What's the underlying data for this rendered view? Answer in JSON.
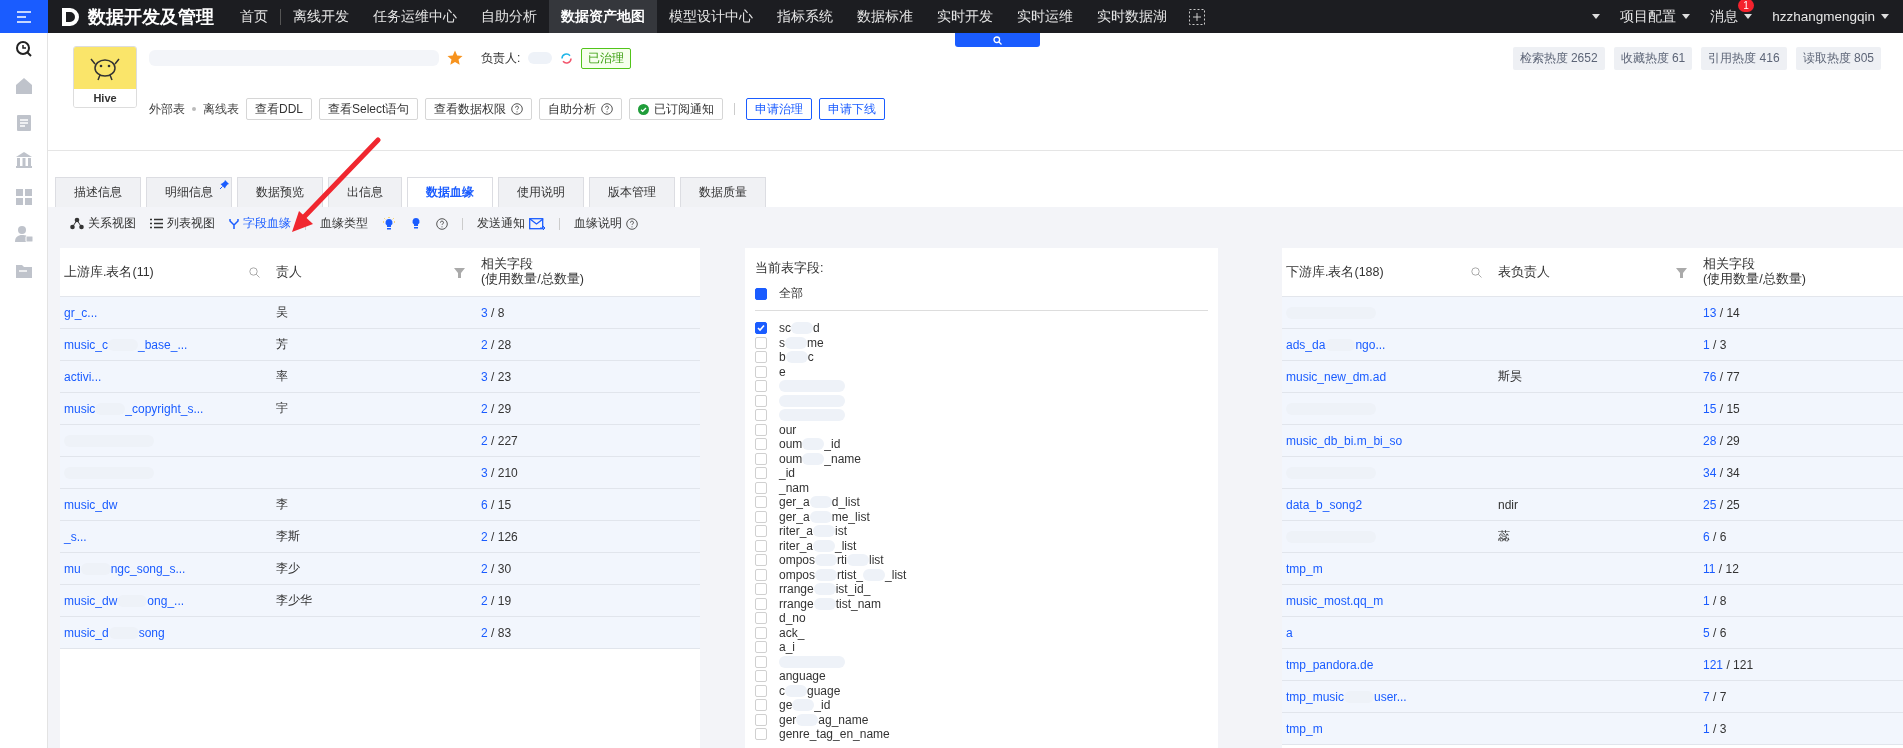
{
  "nav": {
    "brand": "数据开发及管理",
    "items": [
      {
        "label": "首页",
        "selected": false
      },
      {
        "label": "离线开发",
        "selected": false
      },
      {
        "label": "任务运维中心",
        "selected": false
      },
      {
        "label": "自助分析",
        "selected": false
      },
      {
        "label": "数据资产地图",
        "selected": true
      },
      {
        "label": "模型设计中心",
        "selected": false
      },
      {
        "label": "指标系统",
        "selected": false
      },
      {
        "label": "数据标准",
        "selected": false
      },
      {
        "label": "实时开发",
        "selected": false
      },
      {
        "label": "实时运维",
        "selected": false
      },
      {
        "label": "实时数据湖",
        "selected": false
      }
    ],
    "menus": [
      "项目配置",
      "消息",
      "hzzhangmengqin"
    ],
    "message_badge": "1"
  },
  "sidebar": {
    "items": [
      {
        "kind": "search",
        "selected": true
      },
      {
        "kind": "home",
        "selected": false
      },
      {
        "kind": "document",
        "selected": false
      },
      {
        "kind": "bank",
        "selected": false
      },
      {
        "kind": "grid",
        "selected": false
      },
      {
        "kind": "user",
        "selected": false
      },
      {
        "kind": "folder",
        "selected": false
      }
    ]
  },
  "header": {
    "logo_label": "Hive",
    "starred": true,
    "owner_label": "负责人:",
    "status": "已治理",
    "table_tags": [
      "外部表",
      "离线表"
    ],
    "buttons": [
      {
        "label": "查看DDL",
        "kind": "plain"
      },
      {
        "label": "查看Select语句",
        "kind": "plain"
      },
      {
        "label": "查看数据权限",
        "kind": "help"
      },
      {
        "label": "自助分析",
        "kind": "help"
      },
      {
        "label": "已订阅通知",
        "kind": "subscribed"
      },
      {
        "label": "申请治理",
        "kind": "primary"
      },
      {
        "label": "申请下线",
        "kind": "primary"
      }
    ],
    "stats": [
      "检索热度 2652",
      "收藏热度 61",
      "引用热度 416",
      "读取热度 805"
    ]
  },
  "tabs": [
    {
      "label": "描述信息",
      "selected": false,
      "pinned": false
    },
    {
      "label": "明细信息",
      "selected": false,
      "pinned": true
    },
    {
      "label": "数据预览",
      "selected": false,
      "pinned": false
    },
    {
      "label": "出信息",
      "selected": false,
      "pinned": false
    },
    {
      "label": "数据血缘",
      "selected": true,
      "pinned": false
    },
    {
      "label": "使用说明",
      "selected": false,
      "pinned": false
    },
    {
      "label": "版本管理",
      "selected": false,
      "pinned": false
    },
    {
      "label": "数据质量",
      "selected": false,
      "pinned": false
    }
  ],
  "toolbar": {
    "views": [
      {
        "label": "关系视图",
        "kind": "graph",
        "selected": false
      },
      {
        "label": "列表视图",
        "kind": "list",
        "selected": false
      },
      {
        "label": "字段血缘",
        "kind": "fork",
        "selected": true
      }
    ],
    "lineage_type_label": "血缘类型",
    "notify_label": "发送通知",
    "help_label": "血缘说明"
  },
  "upstream": {
    "count_separator": "/",
    "columns": [
      "上游库.表名(11)",
      "责人",
      "相关字段\n(使用数量/总数量)"
    ],
    "rows": [
      {
        "name": [
          "gr_c..."
        ],
        "owner": [
          "吴"
        ],
        "used": "3",
        "total": "8"
      },
      {
        "name": [
          "music_c",
          "_base_..."
        ],
        "owner": [
          "芳"
        ],
        "used": "2",
        "total": "28"
      },
      {
        "name": [
          "activi..."
        ],
        "owner": [
          "率"
        ],
        "used": "3",
        "total": "23"
      },
      {
        "name": [
          "music",
          "_copyright_s..."
        ],
        "owner": [
          "宇"
        ],
        "used": "2",
        "total": "29"
      },
      {
        "used": "2",
        "total": "227"
      },
      {
        "used": "3",
        "total": "210"
      },
      {
        "name": [
          "music_dw"
        ],
        "owner": [
          "李"
        ],
        "used": "6",
        "total": "15"
      },
      {
        "name": [
          "_s..."
        ],
        "owner": [
          "李斯"
        ],
        "used": "2",
        "total": "126"
      },
      {
        "name": [
          "mu",
          "ngc_song_s..."
        ],
        "owner": [
          "李少"
        ],
        "used": "2",
        "total": "30"
      },
      {
        "name": [
          "music_dw",
          "ong_..."
        ],
        "owner": [
          "李少华"
        ],
        "used": "2",
        "total": "19"
      },
      {
        "name": [
          "music_d",
          "song"
        ],
        "used": "2",
        "total": "83"
      }
    ]
  },
  "current_fields": {
    "label": "当前表字段:",
    "all_label": "全部",
    "all_indeterminate": true,
    "items": [
      {
        "parts": [
          "sc",
          "d"
        ],
        "checked": true
      },
      {
        "parts": [
          "s",
          "me"
        ],
        "checked": false
      },
      {
        "parts": [
          "b",
          "c"
        ],
        "checked": false
      },
      {
        "parts": [
          "e"
        ],
        "checked": false
      },
      {
        "checked": false
      },
      {
        "checked": false
      },
      {
        "checked": false
      },
      {
        "parts": [
          "our"
        ],
        "checked": false
      },
      {
        "parts": [
          "oum",
          "_id"
        ],
        "checked": false
      },
      {
        "parts": [
          "oum",
          "_name"
        ],
        "checked": false
      },
      {
        "parts": [
          "_id"
        ],
        "checked": false
      },
      {
        "parts": [
          "_nam"
        ],
        "checked": false
      },
      {
        "parts": [
          "ger_a",
          "d_list"
        ],
        "checked": false
      },
      {
        "parts": [
          "ger_a",
          "me_list"
        ],
        "checked": false
      },
      {
        "parts": [
          "riter_a",
          "ist"
        ],
        "checked": false
      },
      {
        "parts": [
          "riter_a",
          "_list"
        ],
        "checked": false
      },
      {
        "parts": [
          "ompos",
          "rti",
          "list"
        ],
        "checked": false
      },
      {
        "parts": [
          "ompos",
          "rtist_",
          "_list"
        ],
        "checked": false
      },
      {
        "parts": [
          "rrange",
          "ist_id_"
        ],
        "checked": false
      },
      {
        "parts": [
          "rrange",
          "tist_nam"
        ],
        "checked": false
      },
      {
        "parts": [
          "d_no"
        ],
        "checked": false
      },
      {
        "parts": [
          "ack_"
        ],
        "checked": false
      },
      {
        "parts": [
          "a_i"
        ],
        "checked": false
      },
      {
        "checked": false
      },
      {
        "parts": [
          "anguage"
        ],
        "checked": false
      },
      {
        "parts": [
          "c",
          "guage"
        ],
        "checked": false
      },
      {
        "parts": [
          "ge",
          "_id"
        ],
        "checked": false
      },
      {
        "parts": [
          "ger",
          "ag_name"
        ],
        "checked": false
      },
      {
        "parts": [
          "genre_tag_en_name"
        ],
        "checked": false
      }
    ]
  },
  "downstream": {
    "count_separator": "/",
    "columns": [
      "下游库.表名(188)",
      "表负责人",
      "相关字段\n(使用数量/总数量)"
    ],
    "rows": [
      {
        "used": "13",
        "total": "14"
      },
      {
        "name": [
          "ads_da",
          "ngo..."
        ],
        "used": "1",
        "total": "3"
      },
      {
        "name": [
          "music_new_dm.ad"
        ],
        "owner": [
          "斯昊"
        ],
        "used": "76",
        "total": "77"
      },
      {
        "used": "15",
        "total": "15"
      },
      {
        "name": [
          "music_db_bi.m_bi_so"
        ],
        "used": "28",
        "total": "29"
      },
      {
        "used": "34",
        "total": "34"
      },
      {
        "name": [
          "data_b_song2"
        ],
        "owner": [
          "ndir"
        ],
        "used": "25",
        "total": "25"
      },
      {
        "owner": [
          "蕊"
        ],
        "used": "6",
        "total": "6"
      },
      {
        "name": [
          "tmp_m"
        ],
        "used": "11",
        "total": "12"
      },
      {
        "name": [
          "music_most.qq_m"
        ],
        "used": "1",
        "total": "8"
      },
      {
        "name": [
          "a"
        ],
        "used": "5",
        "total": "6"
      },
      {
        "name": [
          "tmp_pandora.de"
        ],
        "used": "121",
        "total": "121"
      },
      {
        "name": [
          "tmp_music",
          "user..."
        ],
        "used": "7",
        "total": "7"
      },
      {
        "name": [
          "tmp_m"
        ],
        "used": "1",
        "total": "3"
      }
    ]
  }
}
